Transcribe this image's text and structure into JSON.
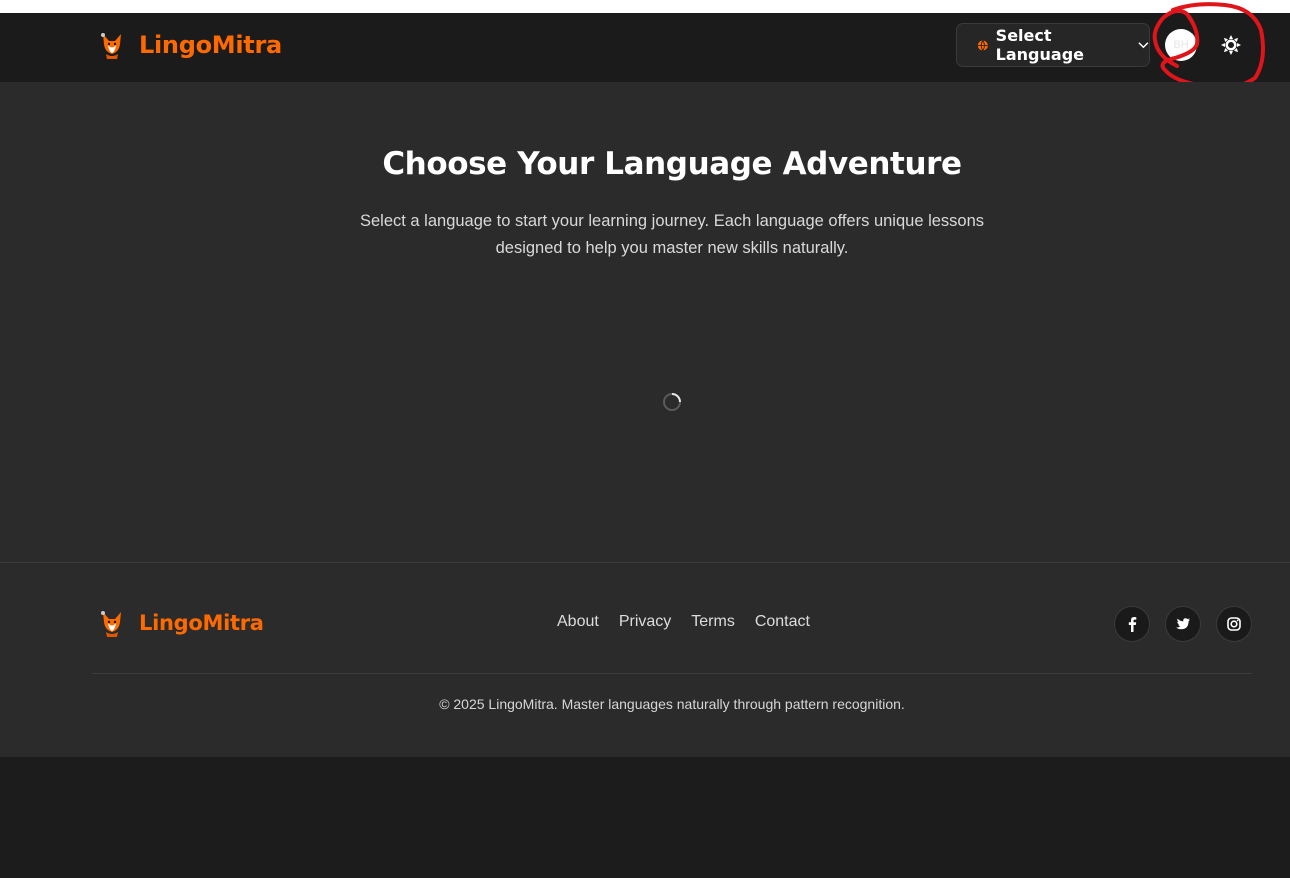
{
  "header": {
    "brand_name": "LingoMitra",
    "language_select_label": "Select Language",
    "avatar_initials": "BH"
  },
  "main": {
    "title": "Choose Your Language Adventure",
    "subtitle": "Select a language to start your learning journey. Each language offers unique lessons designed to help you master new skills naturally."
  },
  "footer": {
    "brand_name": "LingoMitra",
    "links": [
      "About",
      "Privacy",
      "Terms",
      "Contact"
    ],
    "socials": [
      "facebook-icon",
      "twitter-icon",
      "instagram-icon"
    ],
    "copyright": "© 2025 LingoMitra. Master languages naturally through pattern recognition."
  },
  "colors": {
    "brand": "#ff6a00",
    "header_bg": "#1b1b1b",
    "main_bg": "#2b2b2b",
    "annotation": "#e0151b"
  }
}
